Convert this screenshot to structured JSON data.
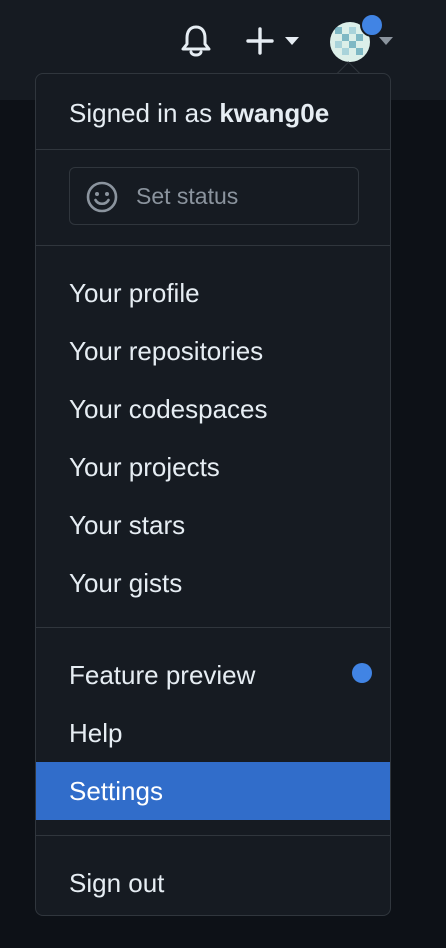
{
  "colors": {
    "background": "#0d1117",
    "header": "#161b22",
    "menu_bg": "#161b22",
    "border": "#30363d",
    "text": "#e6edf3",
    "muted_text": "#8b949e",
    "accent": "#316dca",
    "notification_dot": "#4184e4"
  },
  "header": {
    "icons": [
      "bell-icon",
      "plus-icon",
      "caret-down-icon",
      "avatar",
      "caret-down-icon"
    ]
  },
  "menu": {
    "signed_in_prefix": "Signed in as",
    "username": "kwang0e",
    "status": {
      "icon": "smiley-icon",
      "label": "Set status"
    },
    "section1": [
      {
        "label": "Your profile"
      },
      {
        "label": "Your repositories"
      },
      {
        "label": "Your codespaces"
      },
      {
        "label": "Your projects"
      },
      {
        "label": "Your stars"
      },
      {
        "label": "Your gists"
      }
    ],
    "section2": [
      {
        "label": "Feature preview",
        "has_indicator": true
      },
      {
        "label": "Help"
      },
      {
        "label": "Settings",
        "active": true
      }
    ],
    "sign_out": "Sign out"
  }
}
